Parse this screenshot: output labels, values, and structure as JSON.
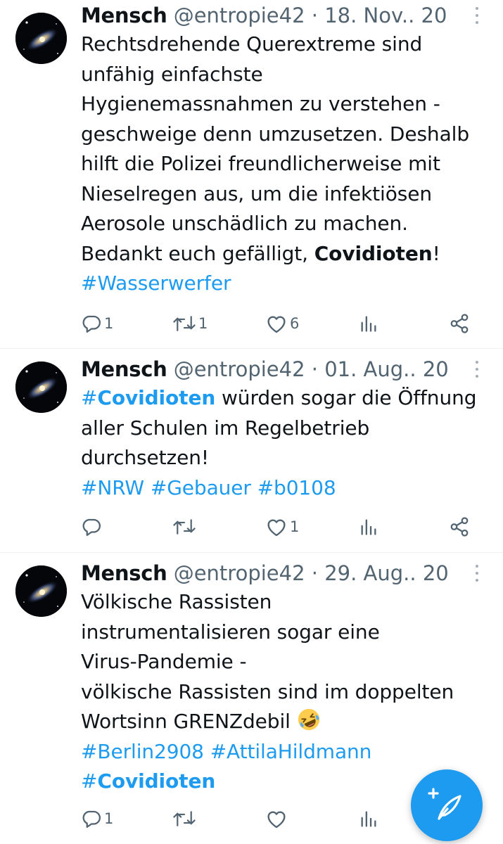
{
  "tweets": [
    {
      "author": "Mensch",
      "handle": "@entropie42",
      "separator": "·",
      "date": "18. Nov.. 20",
      "text_lines": [
        "Rechtsdrehende Querextreme sind",
        "unfähig einfachste",
        "Hygienemassnahmen zu verstehen -",
        "geschweige denn umzusetzen. Deshalb",
        "hilft die Polizei freundlicherweise mit",
        "Nieselregen aus, um die infektiösen",
        "Aerosole unschädlich zu machen."
      ],
      "last_line_prefix": "Bedankt euch gefälligt, ",
      "last_line_bold": "Covidioten",
      "last_line_suffix": "!",
      "hashtags": [
        "#Wasserwerfer"
      ],
      "replies": "1",
      "retweets": "1",
      "likes": "6"
    },
    {
      "author": "Mensch",
      "handle": "@entropie42",
      "separator": "·",
      "date": "01. Aug.. 20",
      "line1_tag_prefix": "#",
      "line1_tag_bold": "Covidioten",
      "line1_rest": " würden sogar die Öffnung",
      "text_lines": [
        "aller Schulen im Regelbetrieb",
        "durchsetzen!"
      ],
      "hashtags": [
        "#NRW",
        "#Gebauer",
        "#b0108"
      ],
      "replies": "",
      "retweets": "",
      "likes": "1"
    },
    {
      "author": "Mensch",
      "handle": "@entropie42",
      "separator": "·",
      "date": "29. Aug.. 20",
      "text_lines": [
        "Völkische Rassisten",
        "instrumentalisieren sogar eine",
        "Virus-Pandemie -",
        "völkische Rassisten sind im doppelten"
      ],
      "line5_text": "Wortsinn GRENZdebil ",
      "emoji": "rolling-on-floor-laughing-emoji",
      "hashtags": [
        "#Berlin2908",
        "#AttilaHildmann"
      ],
      "last_tag_prefix": "#",
      "last_tag_bold": "Covidioten",
      "replies": "1",
      "retweets": "",
      "likes": ""
    }
  ],
  "icons": {
    "reply": "reply-icon",
    "retweet": "retweet-icon",
    "like": "like-icon",
    "views": "views-icon",
    "share": "share-icon",
    "more": "more-icon",
    "compose": "compose-icon"
  },
  "colors": {
    "link": "#1d9bf0",
    "secondary_text": "#536471",
    "divider": "#eff3f4",
    "fab": "#1d9bf0"
  }
}
